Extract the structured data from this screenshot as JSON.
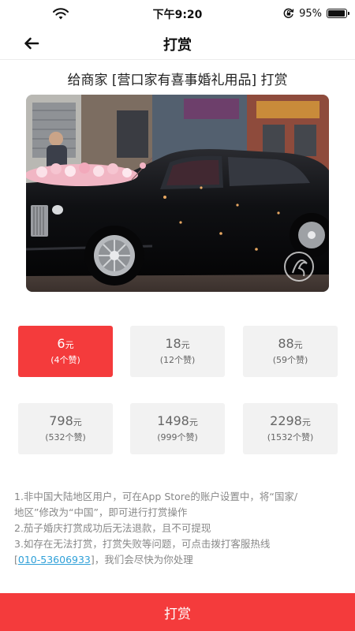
{
  "status_bar": {
    "time": "下午9:20",
    "battery_percent": "95%",
    "battery_level": 0.95,
    "icons": [
      "wifi-icon",
      "orientation-lock-icon",
      "battery-icon"
    ]
  },
  "nav": {
    "title": "打赏",
    "back_icon": "arrow-left-icon"
  },
  "merchant": {
    "prefix": "给商家 [",
    "name": "营口家有喜事婚礼用品",
    "suffix": "] 打赏"
  },
  "hero": {
    "subject": "photo of a black wedding car decorated with flowers",
    "colors": {
      "sky": "#cfd6df",
      "building": "#8a8177",
      "car": "#0d0d0f",
      "flowers": "#f3b3c4"
    }
  },
  "amounts": [
    {
      "value": "6",
      "unit": "元",
      "likes": "(4个赞)",
      "selected": true
    },
    {
      "value": "18",
      "unit": "元",
      "likes": "(12个赞)",
      "selected": false
    },
    {
      "value": "88",
      "unit": "元",
      "likes": "(59个赞)",
      "selected": false
    },
    {
      "value": "798",
      "unit": "元",
      "likes": "(532个赞)",
      "selected": false
    },
    {
      "value": "1498",
      "unit": "元",
      "likes": "(999个赞)",
      "selected": false
    },
    {
      "value": "2298",
      "unit": "元",
      "likes": "(1532个赞)",
      "selected": false
    }
  ],
  "notes": {
    "line1": "1.非中国大陆地区用户，可在App Store的账户设置中，将“国家/",
    "line2": "地区”修改为“中国”，即可进行打赏操作",
    "line3": "2.茄子婚庆打赏成功后无法退款，且不可提现",
    "line4": "3.如存在无法打赏，打赏失败等问题，可点击拨打客服热线",
    "line5_prefix": "[",
    "hotline": "010-53606933",
    "line5_suffix": "]，我们会尽快为你处理"
  },
  "submit": {
    "label": "打赏"
  },
  "colors": {
    "accent": "#f43b3c",
    "card_bg": "#f2f2f2",
    "link": "#2fa0d8",
    "note_text": "#888888"
  }
}
